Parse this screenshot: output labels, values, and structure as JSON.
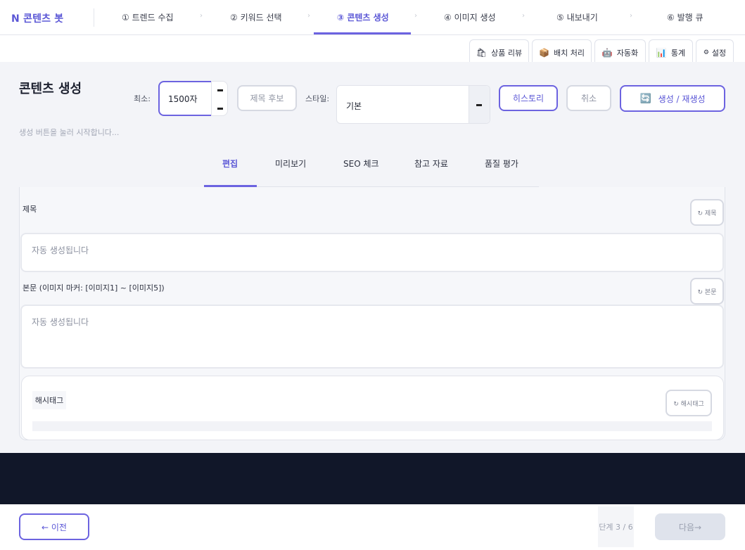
{
  "app": {
    "brand": "N 콘텐츠 봇"
  },
  "steps": [
    {
      "label": "① 트렌드 수집"
    },
    {
      "label": "② 키워드 선택"
    },
    {
      "label": "③ 콘텐츠 생성",
      "active": true
    },
    {
      "label": "④ 이미지 생성"
    },
    {
      "label": "⑤ 내보내기"
    },
    {
      "label": "⑥ 발행 큐"
    }
  ],
  "step_separator": "›",
  "tools": [
    {
      "icon": "shopping-bag-icon",
      "glyph": "🛍",
      "label": "상품 리뷰"
    },
    {
      "icon": "package-icon",
      "glyph": "📦",
      "label": "배치 처리"
    },
    {
      "icon": "robot-icon",
      "glyph": "🤖",
      "label": "자동화"
    },
    {
      "icon": "bar-chart-icon",
      "glyph": "📊",
      "label": "통계"
    },
    {
      "icon": "gear-icon",
      "glyph": "⚙",
      "label": "설정"
    }
  ],
  "main": {
    "title": "콘텐츠 생성",
    "hint": "생성 버튼을 눌러 시작합니다...",
    "min_label": "최소:",
    "min_value": "1500자",
    "title_candidates_button": "제목 후보",
    "style_label": "스타일:",
    "style_value": "기본",
    "history_button": "히스토리",
    "cancel_button": "취소",
    "generate_button": "생성 / 재생성",
    "generate_glyph": "🔄"
  },
  "tabs": [
    {
      "label": "편집",
      "active": true
    },
    {
      "label": "미리보기"
    },
    {
      "label": "SEO 체크"
    },
    {
      "label": "참고 자료"
    },
    {
      "label": "품질 평가"
    }
  ],
  "editor": {
    "title_label": "제목",
    "title_regen": "↻ 제목",
    "title_placeholder": "자동 생성됩니다",
    "body_label": "본문  (이미지 마커: [이미지1] ~ [이미지5])",
    "body_regen": "↻ 본문",
    "body_placeholder": "자동 생성됩니다",
    "hashtag_label": "해시태그",
    "hashtag_regen": "↻ 해시태그"
  },
  "footer": {
    "prev_button": "← 이전",
    "step_indicator": "단계  3 / 6",
    "next_button": "다음→"
  },
  "colors": {
    "accent": "#6c63e0",
    "accent_text": "#5b57d6",
    "dark_band": "#111729",
    "panel_bg": "#f3f4f8"
  }
}
